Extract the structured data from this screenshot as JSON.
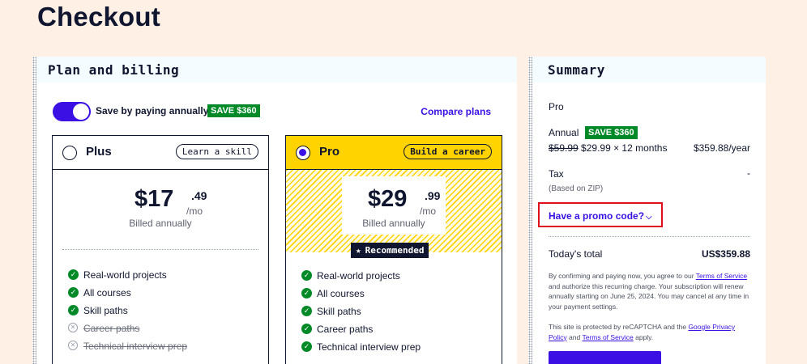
{
  "page": {
    "title": "Checkout"
  },
  "plan_billing": {
    "title": "Plan and billing",
    "toggle_label": "Save by paying annually",
    "toggle_on": true,
    "save_badge": "SAVE $360",
    "compare_link": "Compare plans",
    "plans": [
      {
        "name": "Plus",
        "tag": "Learn a skill",
        "selected": false,
        "price_dollars": "$17",
        "price_cents": ".49",
        "price_unit": "/mo",
        "billed": "Billed annually",
        "features": [
          {
            "text": "Real-world projects",
            "included": true
          },
          {
            "text": "All courses",
            "included": true
          },
          {
            "text": "Skill paths",
            "included": true
          },
          {
            "text": "Career paths",
            "included": false
          },
          {
            "text": "Technical interview prep",
            "included": false
          }
        ]
      },
      {
        "name": "Pro",
        "tag": "Build a career",
        "selected": true,
        "price_dollars": "$29",
        "price_cents": ".99",
        "price_unit": "/mo",
        "billed": "Billed annually",
        "badge": "Recommended",
        "features": [
          {
            "text": "Real-world projects",
            "included": true
          },
          {
            "text": "All courses",
            "included": true
          },
          {
            "text": "Skill paths",
            "included": true
          },
          {
            "text": "Career paths",
            "included": true
          },
          {
            "text": "Technical interview prep",
            "included": true
          }
        ]
      }
    ]
  },
  "summary": {
    "title": "Summary",
    "plan": "Pro",
    "billing_period": "Annual",
    "save_badge": "SAVE $360",
    "original_price": "$59.99",
    "line_detail": "$29.99 × 12 months",
    "line_total": "$359.88/year",
    "tax_label": "Tax",
    "tax_value": "-",
    "tax_note": "(Based on ZIP)",
    "promo_link": "Have a promo code?",
    "today_label": "Today's total",
    "today_value": "US$359.88",
    "legal1_a": "By confirming and paying now, you agree to our ",
    "legal1_link1": "Terms of Service",
    "legal1_b": " and authorize this recurring charge. Your subscription will renew annually starting on June 25, 2024. You may cancel at any time in your payment settings.",
    "legal2_a": "This site is protected by reCAPTCHA and the ",
    "legal2_link1": "Google Privacy Policy",
    "legal2_b": " and ",
    "legal2_link2": "Terms of Service",
    "legal2_c": " apply."
  },
  "colors": {
    "accent": "#3a10e5",
    "save_green": "#008a27",
    "pro_yellow": "#ffd300",
    "page_bg": "#fff0e5",
    "promo_highlight": "#e0101a"
  }
}
